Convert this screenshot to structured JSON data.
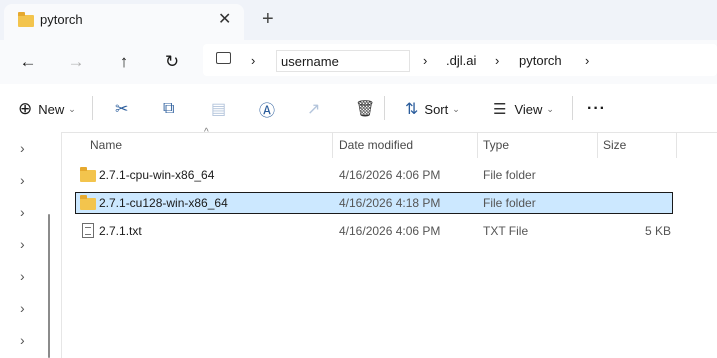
{
  "window": {
    "tab_title": "pytorch",
    "tab_close": "✕",
    "new_tab": "+"
  },
  "nav": {
    "back": "←",
    "forward": "→",
    "up": "↑",
    "refresh": "↻",
    "breadcrumbs": [
      {
        "label": "username"
      },
      {
        "label": ".djl.ai"
      },
      {
        "label": "pytorch"
      }
    ],
    "chevron": "›"
  },
  "commands": {
    "new": "New",
    "sort": "Sort",
    "view": "View",
    "more": "···"
  },
  "columns": {
    "name": "Name",
    "date": "Date modified",
    "type": "Type",
    "size": "Size"
  },
  "files": [
    {
      "name": "2.7.1-cpu-win-x86_64",
      "date": "4/16/2026 4:06 PM",
      "type": "File folder",
      "size": "",
      "icon": "folder-icon",
      "selected": false
    },
    {
      "name": "2.7.1-cu128-win-x86_64",
      "date": "4/16/2026 4:18 PM",
      "type": "File folder",
      "size": "",
      "icon": "folder-icon",
      "selected": true
    },
    {
      "name": "2.7.1.txt",
      "date": "4/16/2026 4:06 PM",
      "type": "TXT File",
      "size": "5 KB",
      "icon": "text-file-icon",
      "selected": false
    }
  ],
  "colors": {
    "selection": "#cce8ff",
    "accent": "#2b5d9c",
    "folder": "#f3c44d"
  }
}
